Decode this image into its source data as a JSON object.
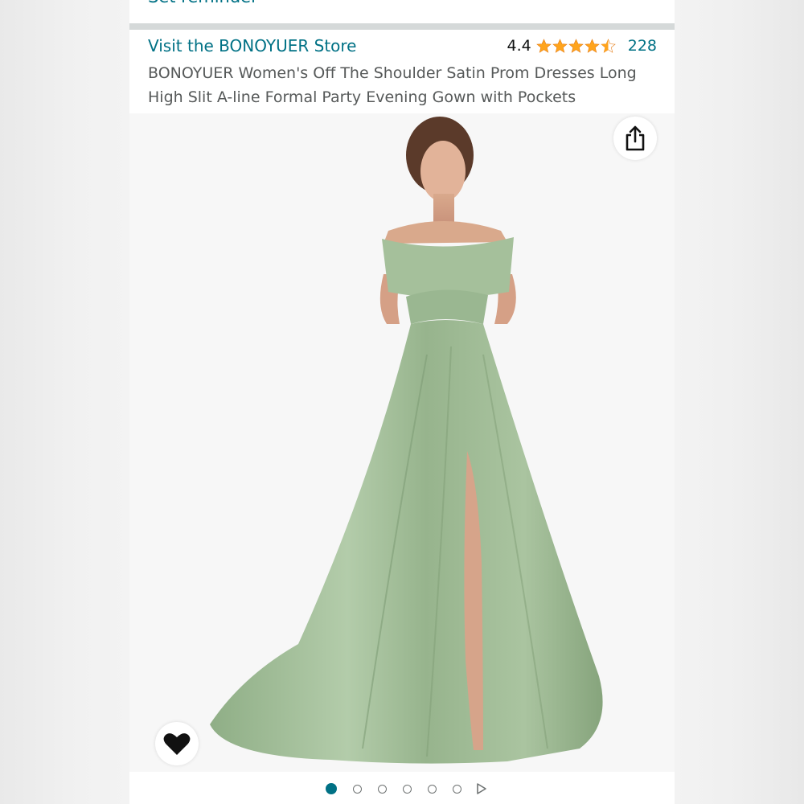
{
  "header": {
    "reminder_label": "Set reminder"
  },
  "product": {
    "store_link": "Visit the BONOYUER Store",
    "rating_value": "4.4",
    "rating_stars": 4.4,
    "rating_count": "228",
    "title": "BONOYUER Women's Off The Shoulder Satin Prom Dresses Long High Slit A-line Formal Party Evening Gown with Pockets"
  },
  "gallery": {
    "image_count": 6,
    "active_index": 0
  },
  "colors": {
    "link": "#007185",
    "star": "#FFA41C",
    "title_text": "#565959",
    "dress": "#9dbb93"
  },
  "icons": {
    "share": "share-icon",
    "wishlist": "heart-icon",
    "play": "play-icon"
  }
}
